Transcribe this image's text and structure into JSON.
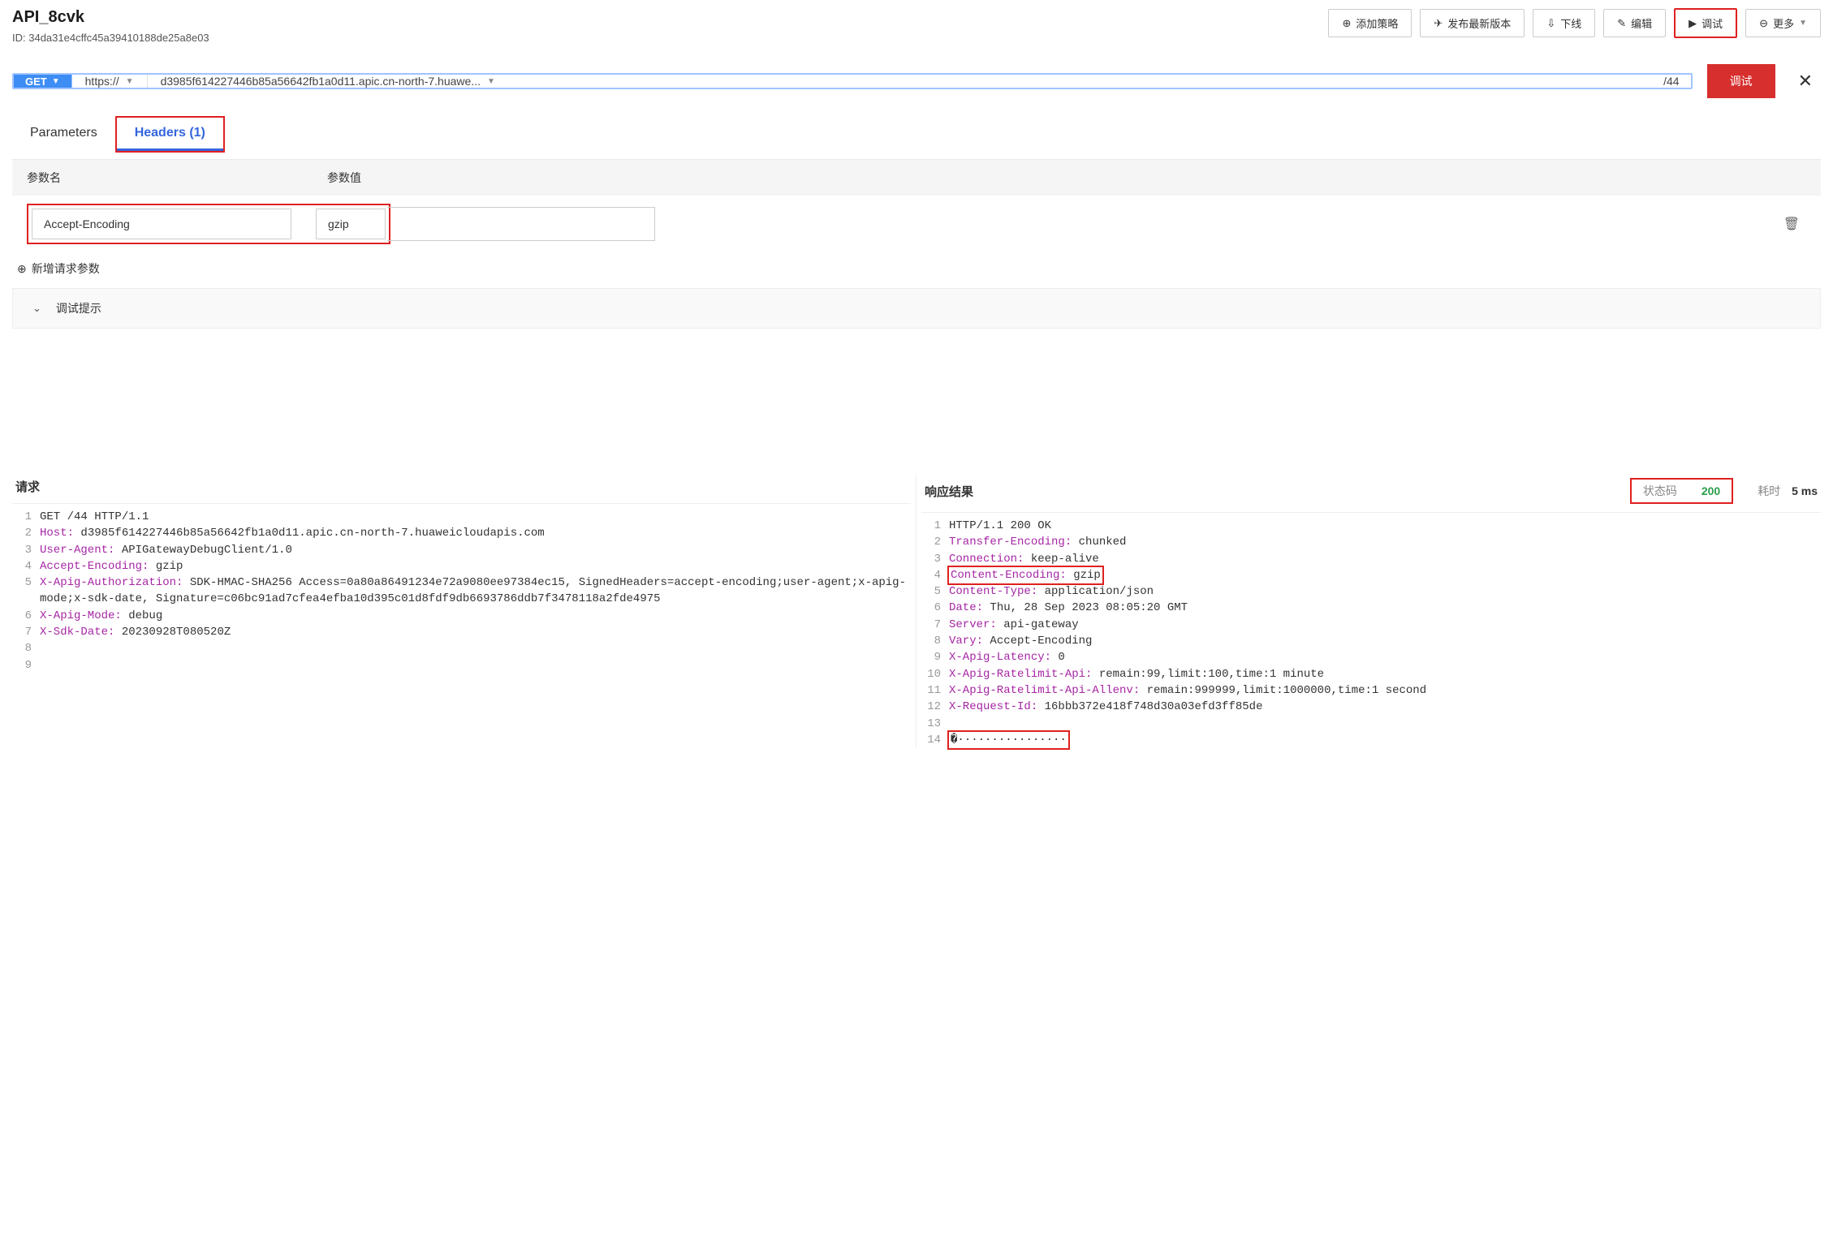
{
  "header": {
    "api_title": "API_8cvk",
    "id_label": "ID: ",
    "api_id": "34da31e4cffc45a39410188de25a8e03",
    "buttons": {
      "add_policy": "添加策略",
      "publish": "发布最新版本",
      "offline": "下线",
      "edit": "编辑",
      "debug": "调试",
      "more": "更多"
    }
  },
  "debug_bar": {
    "method": "GET",
    "scheme": "https://",
    "host": "d3985f614227446b85a56642fb1a0d11.apic.cn-north-7.huawe...",
    "path": "/44",
    "action": "调试"
  },
  "tabs": {
    "parameters": "Parameters",
    "headers": "Headers",
    "headers_count": "(1)"
  },
  "headers_table": {
    "col_name": "参数名",
    "col_value": "参数值",
    "rows": [
      {
        "name": "Accept-Encoding",
        "value": "gzip"
      }
    ]
  },
  "add_param": "新增请求参数",
  "hint": "调试提示",
  "request": {
    "title": "请求",
    "lines": [
      {
        "n": 1,
        "prefix": "",
        "k": "",
        "v": "GET /44 HTTP/1.1"
      },
      {
        "n": 2,
        "prefix": "",
        "k": "Host:",
        "v": " d3985f614227446b85a56642fb1a0d11.apic.cn-north-7.huaweicloudapis.com",
        "wrap": true
      },
      {
        "n": 3,
        "prefix": "",
        "k": "User-Agent:",
        "v": " APIGatewayDebugClient/1.0"
      },
      {
        "n": 4,
        "prefix": "",
        "k": "Accept-Encoding:",
        "v": " gzip"
      },
      {
        "n": 5,
        "prefix": "",
        "k": "X-Apig-Authorization:",
        "v": " SDK-HMAC-SHA256 Access=0a80a86491234e72a9080ee97384ec15, SignedHeaders=accept-encoding;user-agent;x-apig-mode;x-sdk-date, Signature=c06bc91ad7cfea4efba10d395c01d8fdf9db6693786ddb7f3478118a2fde4975",
        "wrap": true
      },
      {
        "n": 6,
        "prefix": "",
        "k": "X-Apig-Mode:",
        "v": " debug"
      },
      {
        "n": 7,
        "prefix": "",
        "k": "X-Sdk-Date:",
        "v": " 20230928T080520Z"
      },
      {
        "n": 8,
        "prefix": "",
        "k": "",
        "v": ""
      },
      {
        "n": 9,
        "prefix": "",
        "k": "",
        "v": ""
      }
    ]
  },
  "response": {
    "title": "响应结果",
    "status_label": "状态码",
    "status_code": "200",
    "latency_label": "耗时",
    "latency_value": "5 ms",
    "lines": [
      {
        "n": 1,
        "k": "",
        "v": "HTTP/1.1 200 OK"
      },
      {
        "n": 2,
        "k": "Transfer-Encoding:",
        "v": " chunked"
      },
      {
        "n": 3,
        "k": "Connection:",
        "v": " keep-alive"
      },
      {
        "n": 4,
        "k": "Content-Encoding:",
        "v": " gzip",
        "hl": true
      },
      {
        "n": 5,
        "k": "Content-Type:",
        "v": " application/json"
      },
      {
        "n": 6,
        "k": "Date:",
        "v": " Thu, 28 Sep 2023 08:05:20 GMT"
      },
      {
        "n": 7,
        "k": "Server:",
        "v": " api-gateway"
      },
      {
        "n": 8,
        "k": "Vary:",
        "v": " Accept-Encoding"
      },
      {
        "n": 9,
        "k": "X-Apig-Latency:",
        "v": " 0"
      },
      {
        "n": 10,
        "k": "X-Apig-Ratelimit-Api:",
        "v": " remain:99,limit:100,time:1 minute"
      },
      {
        "n": 11,
        "k": "X-Apig-Ratelimit-Api-Allenv:",
        "v": " remain:999999,limit:1000000,time:1 second"
      },
      {
        "n": 12,
        "k": "X-Request-Id:",
        "v": " 16bbb372e418f748d30a03efd3ff85de"
      },
      {
        "n": 13,
        "k": "",
        "v": ""
      },
      {
        "n": 14,
        "k": "",
        "v": "�················",
        "hl": true
      }
    ]
  }
}
